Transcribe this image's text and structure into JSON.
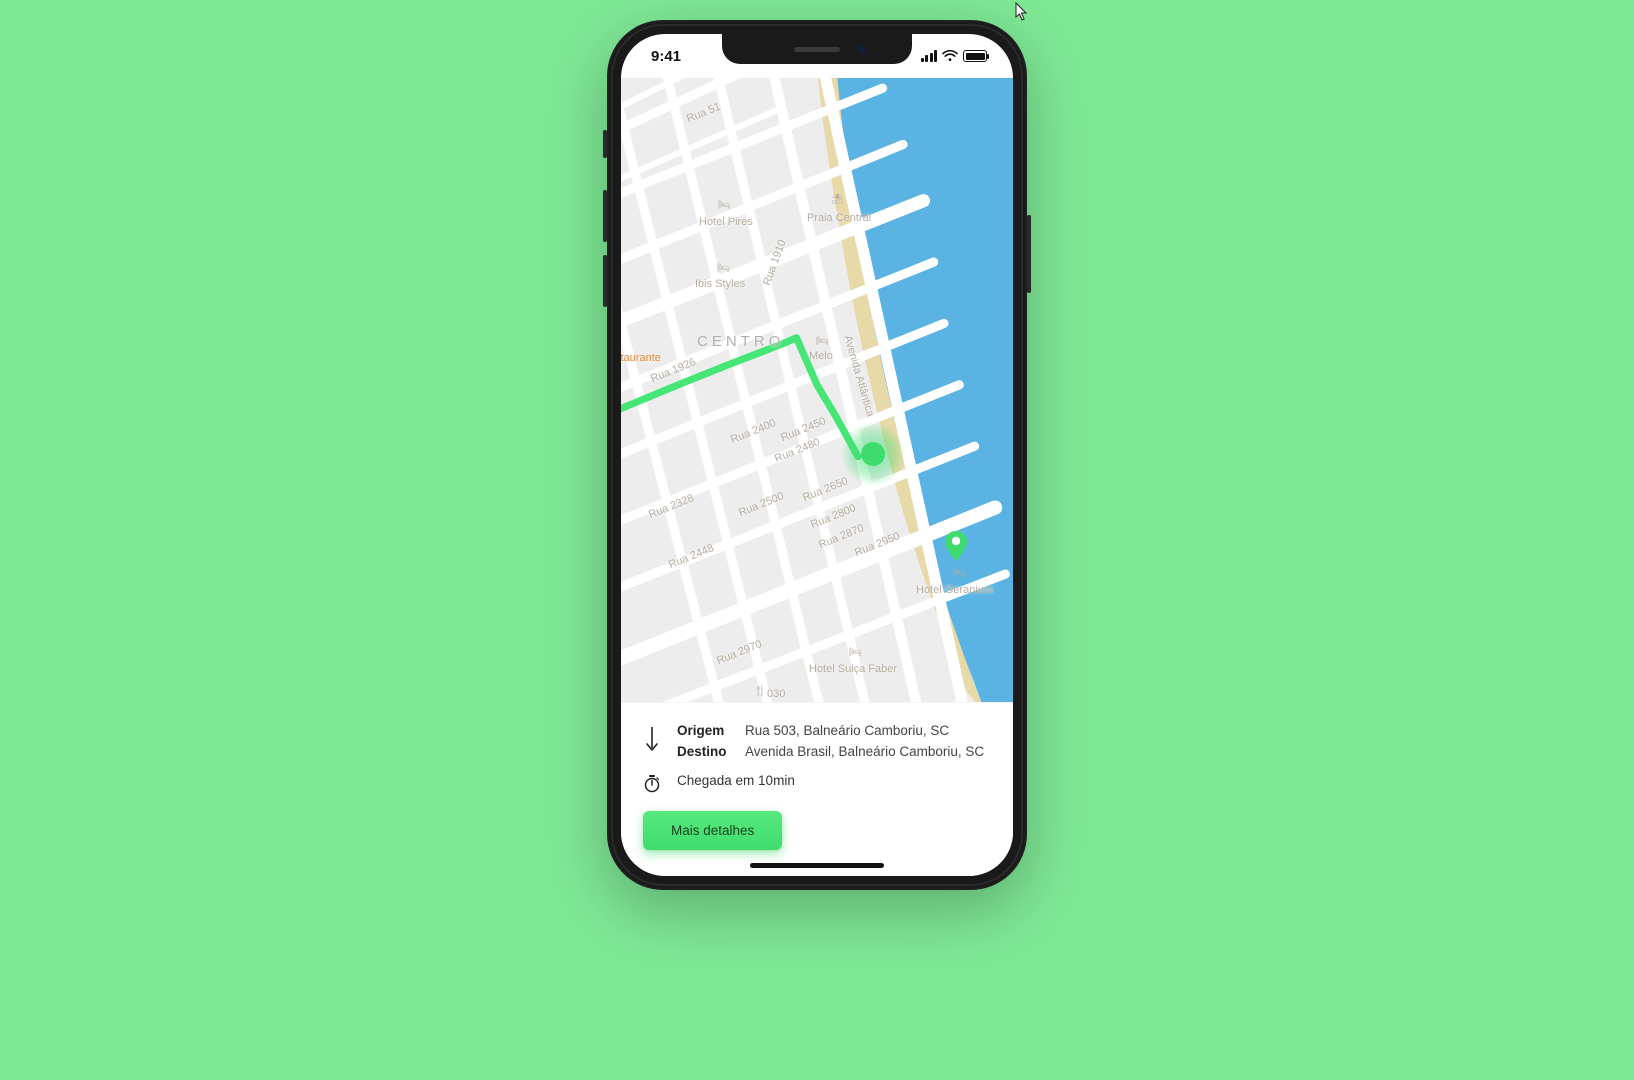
{
  "statusbar": {
    "time": "9:41"
  },
  "map": {
    "district": "CENTRO",
    "restaurant_label": "staurante",
    "streets": {
      "rua51": "Rua 51",
      "rua1910": "Rua 1910",
      "rua1926": "Rua 1926",
      "rua2400": "Rua 2400",
      "rua2450": "Rua 2450",
      "rua2480": "Rua 2480",
      "rua2500": "Rua 2500",
      "rua2650": "Rua 2650",
      "rua2800": "Rua 2800",
      "rua2870": "Rua 2870",
      "rua2950": "Rua 2950",
      "rua2328": "Rua 2328",
      "rua2448": "Rua 2448",
      "rua2970": "Rua 2970",
      "avatlantica": "Avenida Atlântica",
      "n030": "030"
    },
    "pois": {
      "hotel_pires": "Hotel Pires",
      "praia_central": "Praia Central",
      "ibis_styles": "Ibis Styles",
      "melo": "Melo",
      "hotel_geranium": "Hotel Geranium",
      "hotel_suica_faber": "Hotel Suiça Faber"
    }
  },
  "card": {
    "origin_label": "Origem",
    "origin_value": "Rua 503, Balneário Camboriu, SC",
    "dest_label": "Destino",
    "dest_value": "Avenida Brasil, Balneário Camboriu, SC",
    "eta": "Chegada em 10min",
    "cta": "Mais detalhes"
  }
}
